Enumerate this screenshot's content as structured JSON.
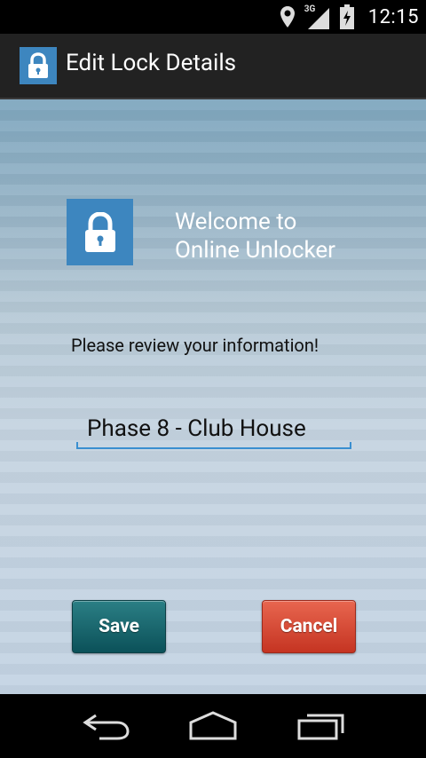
{
  "status_bar": {
    "network_label": "3G",
    "clock": "12:15",
    "icons": [
      "location-icon",
      "signal-icon",
      "battery-icon"
    ]
  },
  "action_bar": {
    "app_icon": "lock-icon",
    "title": "Edit Lock Details"
  },
  "main": {
    "welcome_line1": "Welcome to",
    "welcome_line2": "Online Unlocker",
    "prompt": "Please review your information!",
    "lock_name_value": "Phase 8 - Club House",
    "save_label": "Save",
    "cancel_label": "Cancel"
  },
  "nav_bar": {
    "buttons": [
      "back-icon",
      "home-icon",
      "recent-apps-icon"
    ]
  },
  "colors": {
    "accent_blue": "#3d86bf",
    "save_button": "#0b5159",
    "cancel_button": "#c53422",
    "field_underline": "#3a8fd0"
  }
}
